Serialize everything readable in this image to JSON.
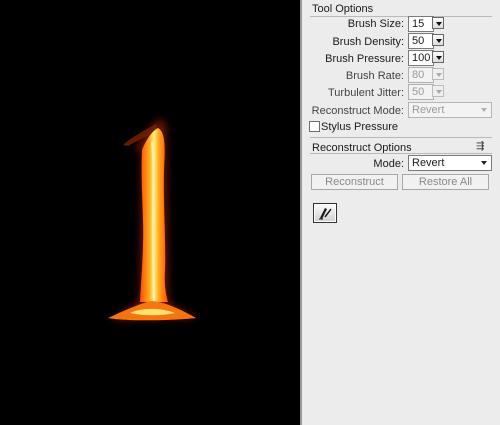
{
  "tool_options": {
    "title": "Tool Options",
    "brush_size": {
      "label": "Brush Size:",
      "value": "15"
    },
    "brush_density": {
      "label": "Brush Density:",
      "value": "50"
    },
    "brush_pressure": {
      "label": "Brush Pressure:",
      "value": "100"
    },
    "brush_rate": {
      "label": "Brush Rate:",
      "value": "80"
    },
    "turbulent_jitter": {
      "label": "Turbulent Jitter:",
      "value": "50"
    },
    "reconstruct_mode": {
      "label": "Reconstruct Mode:",
      "value": "Revert"
    },
    "stylus_pressure": {
      "label": "Stylus Pressure",
      "checked": false
    }
  },
  "reconstruct_options": {
    "title": "Reconstruct Options",
    "mode": {
      "label": "Mode:",
      "value": "Revert"
    },
    "reconstruct_label": "Reconstruct",
    "restore_all_label": "Restore All"
  },
  "icons": {
    "panel_menu": "panel-menu-icon",
    "tool": "reconstruct-tool-icon"
  },
  "colors": {
    "canvas_bg": "#000000",
    "panel_bg": "#ececec",
    "fire_core": "#ffd84a",
    "fire_edge": "#ff5a00"
  }
}
